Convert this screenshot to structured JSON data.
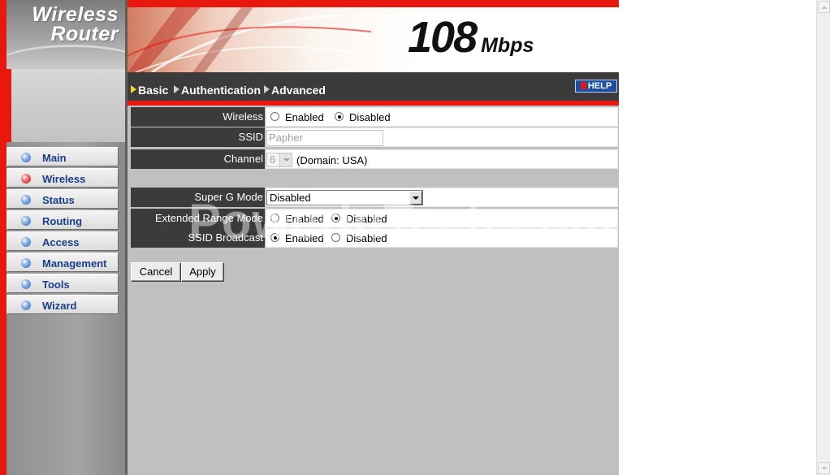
{
  "logo": {
    "line1": "Wireless",
    "line2": "Router"
  },
  "banner": {
    "speed": "108",
    "unit": "Mbps"
  },
  "tabs": [
    {
      "label": "Basic"
    },
    {
      "label": "Authentication"
    },
    {
      "label": "Advanced"
    }
  ],
  "help_label": "HELP",
  "sidebar": {
    "items": [
      {
        "label": "Main",
        "active": false
      },
      {
        "label": "Wireless",
        "active": true
      },
      {
        "label": "Status",
        "active": false
      },
      {
        "label": "Routing",
        "active": false
      },
      {
        "label": "Access",
        "active": false
      },
      {
        "label": "Management",
        "active": false
      },
      {
        "label": "Tools",
        "active": false
      },
      {
        "label": "Wizard",
        "active": false
      }
    ]
  },
  "form": {
    "wireless": {
      "label": "Wireless",
      "opt_enabled": "Enabled",
      "opt_disabled": "Disabled",
      "value": "Disabled"
    },
    "ssid": {
      "label": "SSID",
      "value": "Papher"
    },
    "channel": {
      "label": "Channel",
      "value": "6",
      "domain": "(Domain: USA)"
    },
    "super_g": {
      "label": "Super G Mode",
      "value": "Disabled"
    },
    "extended_range": {
      "label": "Extended Range Mode",
      "opt_enabled": "Enabled",
      "opt_disabled": "Disabled",
      "value": "Disabled"
    },
    "ssid_broadcast": {
      "label": "SSID Broadcast",
      "opt_enabled": "Enabled",
      "opt_disabled": "Disabled",
      "value": "Enabled"
    }
  },
  "buttons": {
    "cancel": "Cancel",
    "apply": "Apply"
  },
  "watermark": "PowerInTech.com",
  "colors": {
    "accent_red": "#e8180f",
    "dark_bar": "#3b3b3b",
    "nav_text": "#1a3f8a",
    "help_blue": "#1c4fa3"
  }
}
